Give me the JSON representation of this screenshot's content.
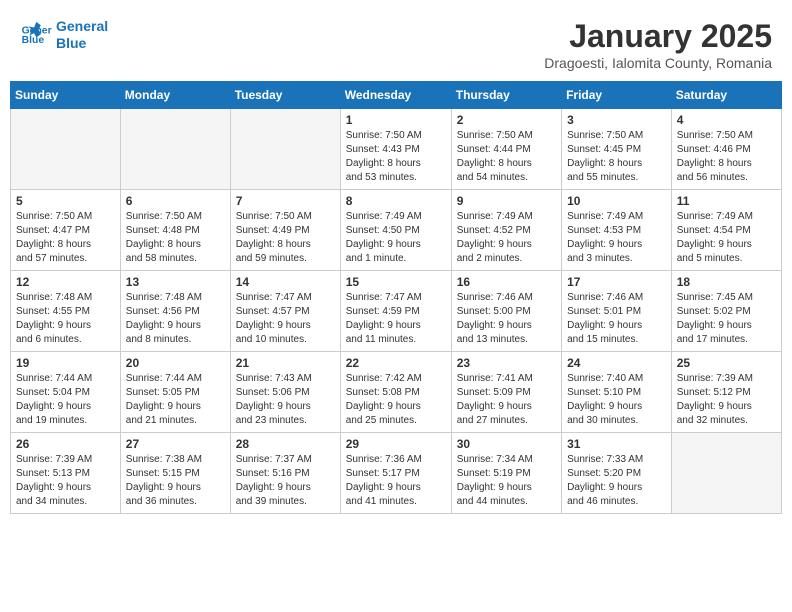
{
  "app": {
    "name": "GeneralBlue",
    "logo_text_1": "General",
    "logo_text_2": "Blue"
  },
  "calendar": {
    "title": "January 2025",
    "subtitle": "Dragoesti, Ialomita County, Romania"
  },
  "headers": [
    "Sunday",
    "Monday",
    "Tuesday",
    "Wednesday",
    "Thursday",
    "Friday",
    "Saturday"
  ],
  "weeks": [
    [
      {
        "num": "",
        "info": "",
        "empty": true
      },
      {
        "num": "",
        "info": "",
        "empty": true
      },
      {
        "num": "",
        "info": "",
        "empty": true
      },
      {
        "num": "1",
        "info": "Sunrise: 7:50 AM\nSunset: 4:43 PM\nDaylight: 8 hours\nand 53 minutes.",
        "empty": false
      },
      {
        "num": "2",
        "info": "Sunrise: 7:50 AM\nSunset: 4:44 PM\nDaylight: 8 hours\nand 54 minutes.",
        "empty": false
      },
      {
        "num": "3",
        "info": "Sunrise: 7:50 AM\nSunset: 4:45 PM\nDaylight: 8 hours\nand 55 minutes.",
        "empty": false
      },
      {
        "num": "4",
        "info": "Sunrise: 7:50 AM\nSunset: 4:46 PM\nDaylight: 8 hours\nand 56 minutes.",
        "empty": false
      }
    ],
    [
      {
        "num": "5",
        "info": "Sunrise: 7:50 AM\nSunset: 4:47 PM\nDaylight: 8 hours\nand 57 minutes.",
        "empty": false
      },
      {
        "num": "6",
        "info": "Sunrise: 7:50 AM\nSunset: 4:48 PM\nDaylight: 8 hours\nand 58 minutes.",
        "empty": false
      },
      {
        "num": "7",
        "info": "Sunrise: 7:50 AM\nSunset: 4:49 PM\nDaylight: 8 hours\nand 59 minutes.",
        "empty": false
      },
      {
        "num": "8",
        "info": "Sunrise: 7:49 AM\nSunset: 4:50 PM\nDaylight: 9 hours\nand 1 minute.",
        "empty": false
      },
      {
        "num": "9",
        "info": "Sunrise: 7:49 AM\nSunset: 4:52 PM\nDaylight: 9 hours\nand 2 minutes.",
        "empty": false
      },
      {
        "num": "10",
        "info": "Sunrise: 7:49 AM\nSunset: 4:53 PM\nDaylight: 9 hours\nand 3 minutes.",
        "empty": false
      },
      {
        "num": "11",
        "info": "Sunrise: 7:49 AM\nSunset: 4:54 PM\nDaylight: 9 hours\nand 5 minutes.",
        "empty": false
      }
    ],
    [
      {
        "num": "12",
        "info": "Sunrise: 7:48 AM\nSunset: 4:55 PM\nDaylight: 9 hours\nand 6 minutes.",
        "empty": false
      },
      {
        "num": "13",
        "info": "Sunrise: 7:48 AM\nSunset: 4:56 PM\nDaylight: 9 hours\nand 8 minutes.",
        "empty": false
      },
      {
        "num": "14",
        "info": "Sunrise: 7:47 AM\nSunset: 4:57 PM\nDaylight: 9 hours\nand 10 minutes.",
        "empty": false
      },
      {
        "num": "15",
        "info": "Sunrise: 7:47 AM\nSunset: 4:59 PM\nDaylight: 9 hours\nand 11 minutes.",
        "empty": false
      },
      {
        "num": "16",
        "info": "Sunrise: 7:46 AM\nSunset: 5:00 PM\nDaylight: 9 hours\nand 13 minutes.",
        "empty": false
      },
      {
        "num": "17",
        "info": "Sunrise: 7:46 AM\nSunset: 5:01 PM\nDaylight: 9 hours\nand 15 minutes.",
        "empty": false
      },
      {
        "num": "18",
        "info": "Sunrise: 7:45 AM\nSunset: 5:02 PM\nDaylight: 9 hours\nand 17 minutes.",
        "empty": false
      }
    ],
    [
      {
        "num": "19",
        "info": "Sunrise: 7:44 AM\nSunset: 5:04 PM\nDaylight: 9 hours\nand 19 minutes.",
        "empty": false
      },
      {
        "num": "20",
        "info": "Sunrise: 7:44 AM\nSunset: 5:05 PM\nDaylight: 9 hours\nand 21 minutes.",
        "empty": false
      },
      {
        "num": "21",
        "info": "Sunrise: 7:43 AM\nSunset: 5:06 PM\nDaylight: 9 hours\nand 23 minutes.",
        "empty": false
      },
      {
        "num": "22",
        "info": "Sunrise: 7:42 AM\nSunset: 5:08 PM\nDaylight: 9 hours\nand 25 minutes.",
        "empty": false
      },
      {
        "num": "23",
        "info": "Sunrise: 7:41 AM\nSunset: 5:09 PM\nDaylight: 9 hours\nand 27 minutes.",
        "empty": false
      },
      {
        "num": "24",
        "info": "Sunrise: 7:40 AM\nSunset: 5:10 PM\nDaylight: 9 hours\nand 30 minutes.",
        "empty": false
      },
      {
        "num": "25",
        "info": "Sunrise: 7:39 AM\nSunset: 5:12 PM\nDaylight: 9 hours\nand 32 minutes.",
        "empty": false
      }
    ],
    [
      {
        "num": "26",
        "info": "Sunrise: 7:39 AM\nSunset: 5:13 PM\nDaylight: 9 hours\nand 34 minutes.",
        "empty": false
      },
      {
        "num": "27",
        "info": "Sunrise: 7:38 AM\nSunset: 5:15 PM\nDaylight: 9 hours\nand 36 minutes.",
        "empty": false
      },
      {
        "num": "28",
        "info": "Sunrise: 7:37 AM\nSunset: 5:16 PM\nDaylight: 9 hours\nand 39 minutes.",
        "empty": false
      },
      {
        "num": "29",
        "info": "Sunrise: 7:36 AM\nSunset: 5:17 PM\nDaylight: 9 hours\nand 41 minutes.",
        "empty": false
      },
      {
        "num": "30",
        "info": "Sunrise: 7:34 AM\nSunset: 5:19 PM\nDaylight: 9 hours\nand 44 minutes.",
        "empty": false
      },
      {
        "num": "31",
        "info": "Sunrise: 7:33 AM\nSunset: 5:20 PM\nDaylight: 9 hours\nand 46 minutes.",
        "empty": false
      },
      {
        "num": "",
        "info": "",
        "empty": true
      }
    ]
  ]
}
